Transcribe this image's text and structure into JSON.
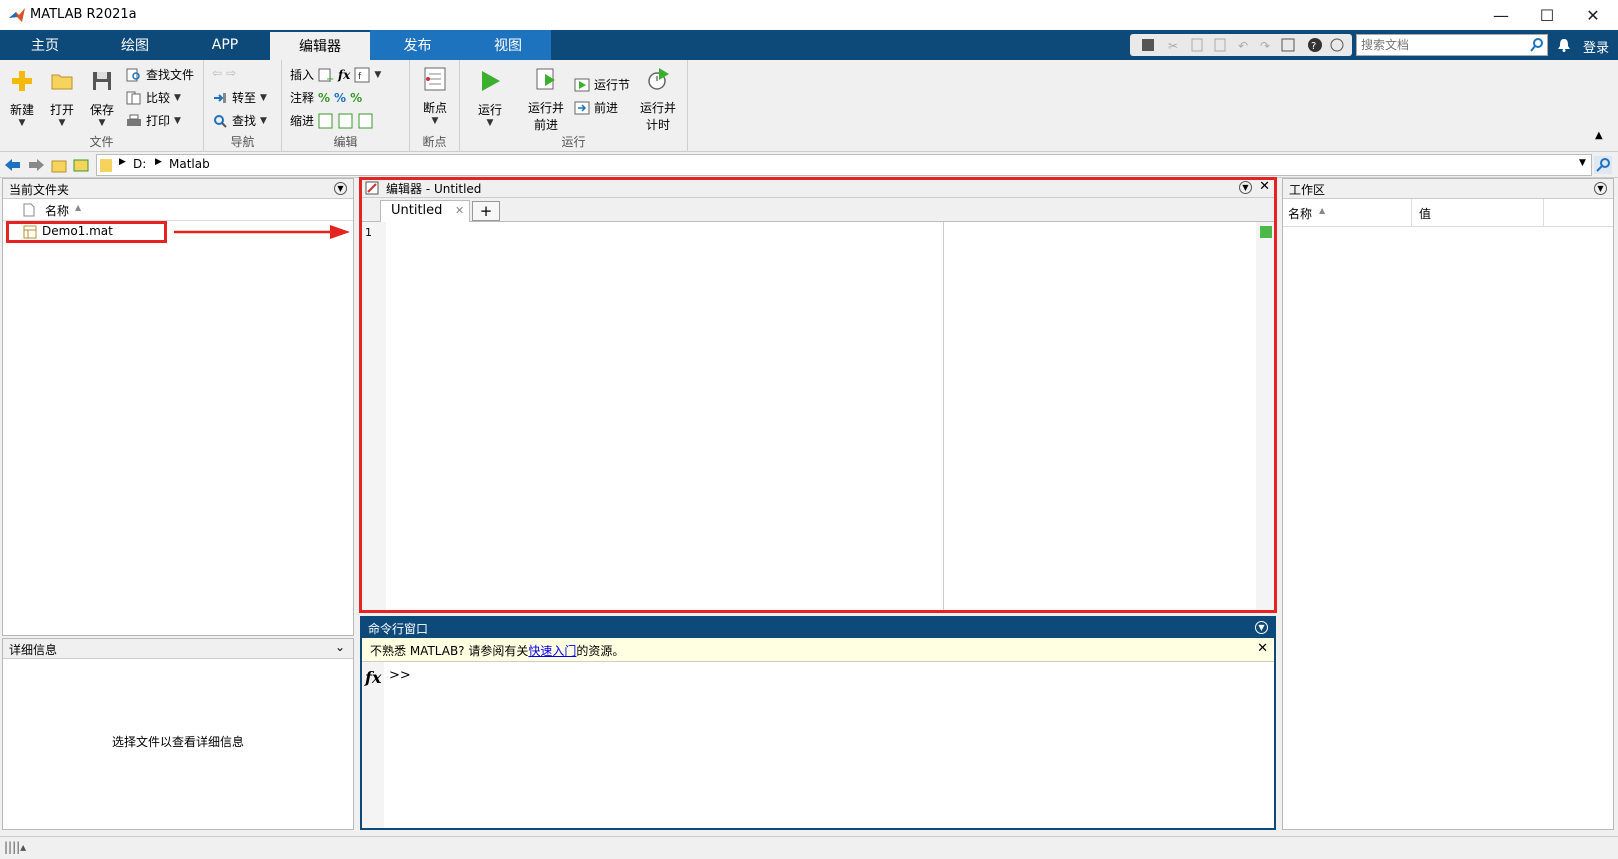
{
  "app": {
    "title": "MATLAB R2021a"
  },
  "tabs": [
    {
      "label": "主页"
    },
    {
      "label": "绘图"
    },
    {
      "label": "APP"
    },
    {
      "label": "编辑器"
    },
    {
      "label": "发布"
    },
    {
      "label": "视图"
    }
  ],
  "search": {
    "placeholder": "搜索文档"
  },
  "login": "登录",
  "ribbon": {
    "file": {
      "group": "文件",
      "new": "新建",
      "open": "打开",
      "save": "保存",
      "find_files": "查找文件",
      "compare": "比较",
      "print": "打印"
    },
    "nav": {
      "group": "导航",
      "goto": "转至",
      "find": "查找"
    },
    "edit": {
      "group": "编辑",
      "insert": "插入",
      "comment": "注释",
      "indent": "缩进",
      "fx": "fx"
    },
    "breakpoints": {
      "group": "断点",
      "label": "断点"
    },
    "run": {
      "group": "运行",
      "run": "运行",
      "run_advance_1": "运行并",
      "run_advance_2": "前进",
      "run_section": "运行节",
      "advance": "前进",
      "run_time_1": "运行并",
      "run_time_2": "计时"
    }
  },
  "address": {
    "drive": "D:",
    "folder": "Matlab"
  },
  "current_folder": {
    "title": "当前文件夹",
    "col_name": "名称",
    "files": [
      {
        "name": "Demo1.mat"
      }
    ]
  },
  "details": {
    "title": "详细信息",
    "message": "选择文件以查看详细信息"
  },
  "editor": {
    "title": "编辑器 - Untitled",
    "tab": "Untitled",
    "line_number": "1"
  },
  "command": {
    "title": "命令行窗口",
    "notice_pre": "不熟悉 MATLAB? 请参阅有关",
    "notice_link": "快速入门",
    "notice_post": "的资源。",
    "prompt": ">>"
  },
  "workspace": {
    "title": "工作区",
    "col_name": "名称",
    "col_value": "值"
  },
  "colors": {
    "tabstrip": "#0d4a7a",
    "highlight": "#e52320"
  }
}
